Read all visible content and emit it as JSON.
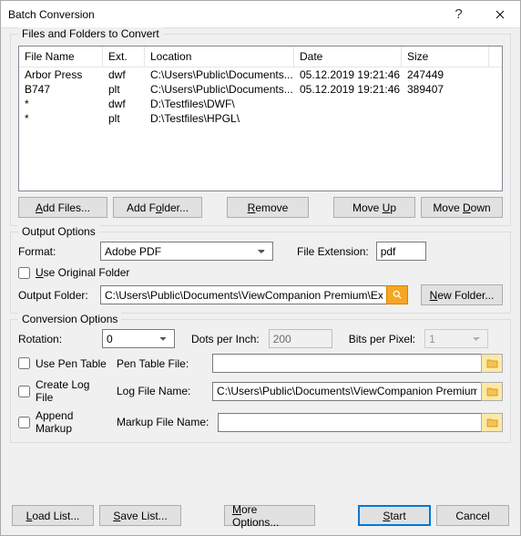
{
  "titlebar": {
    "title": "Batch Conversion"
  },
  "filesGroup": {
    "label": "Files and Folders to Convert",
    "columns": {
      "name": "File Name",
      "ext": "Ext.",
      "loc": "Location",
      "date": "Date",
      "size": "Size"
    },
    "rows": [
      {
        "name": "Arbor Press",
        "ext": "dwf",
        "loc": "C:\\Users\\Public\\Documents...",
        "date": "05.12.2019  19:21:46",
        "size": "247449"
      },
      {
        "name": "B747",
        "ext": "plt",
        "loc": "C:\\Users\\Public\\Documents...",
        "date": "05.12.2019  19:21:46",
        "size": "389407"
      },
      {
        "name": "*",
        "ext": "dwf",
        "loc": "D:\\Testfiles\\DWF\\",
        "date": "",
        "size": ""
      },
      {
        "name": "*",
        "ext": "plt",
        "loc": "D:\\Testfiles\\HPGL\\",
        "date": "",
        "size": ""
      }
    ],
    "buttons": {
      "addFiles": "Add Files...",
      "addFolder": "Add Folder...",
      "remove": "Remove",
      "moveUp": "Move Up",
      "moveDown": "Move Down"
    }
  },
  "outputGroup": {
    "label": "Output Options",
    "formatLabel": "Format:",
    "formatValue": "Adobe PDF",
    "fileExtLabel": "File Extension:",
    "fileExtValue": "pdf",
    "useOriginal": "Use Original Folder",
    "outputFolderLabel": "Output Folder:",
    "outputFolderValue": "C:\\Users\\Public\\Documents\\ViewCompanion Premium\\Export",
    "newFolder": "New Folder..."
  },
  "convGroup": {
    "label": "Conversion Options",
    "rotationLabel": "Rotation:",
    "rotationValue": "0",
    "dpiLabel": "Dots per Inch:",
    "dpiValue": "200",
    "bppLabel": "Bits per Pixel:",
    "bppValue": "1",
    "usePenTable": "Use Pen Table",
    "penTableLabel": "Pen Table File:",
    "penTableValue": "",
    "createLog": "Create Log File",
    "logFileLabel": "Log File Name:",
    "logFileValue": "C:\\Users\\Public\\Documents\\ViewCompanion Premium\\Rep",
    "appendMarkup": "Append Markup",
    "markupLabel": "Markup File Name:",
    "markupValue": ""
  },
  "bottom": {
    "loadList": "Load List...",
    "saveList": "Save List...",
    "moreOptions": "More Options...",
    "start": "Start",
    "cancel": "Cancel"
  }
}
